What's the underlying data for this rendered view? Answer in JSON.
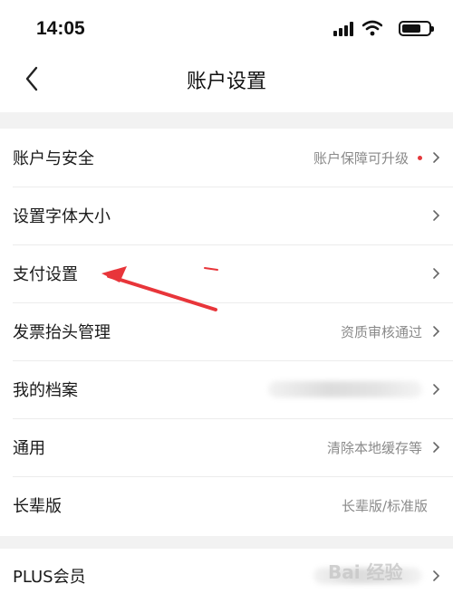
{
  "status_bar": {
    "time": "14:05"
  },
  "header": {
    "title": "账户设置"
  },
  "settings": [
    {
      "label": "账户与安全",
      "value": "账户保障可升级",
      "badge": true
    },
    {
      "label": "设置字体大小",
      "value": ""
    },
    {
      "label": "支付设置",
      "value": ""
    },
    {
      "label": "发票抬头管理",
      "value": "资质审核通过"
    },
    {
      "label": "我的档案",
      "value": ""
    },
    {
      "label": "通用",
      "value": "清除本地缓存等"
    },
    {
      "label": "长辈版",
      "value": "长辈版/标准版"
    }
  ],
  "plus": {
    "label": "PLUS会员"
  },
  "watermark": "Bai 经验",
  "colors": {
    "accent_red": "#e4393c",
    "background": "#f2f2f2",
    "card": "#ffffff"
  },
  "icons": [
    "signal-icon",
    "wifi-icon",
    "battery-icon",
    "back-chevron-icon",
    "chevron-right-icon",
    "annotation-arrow"
  ]
}
